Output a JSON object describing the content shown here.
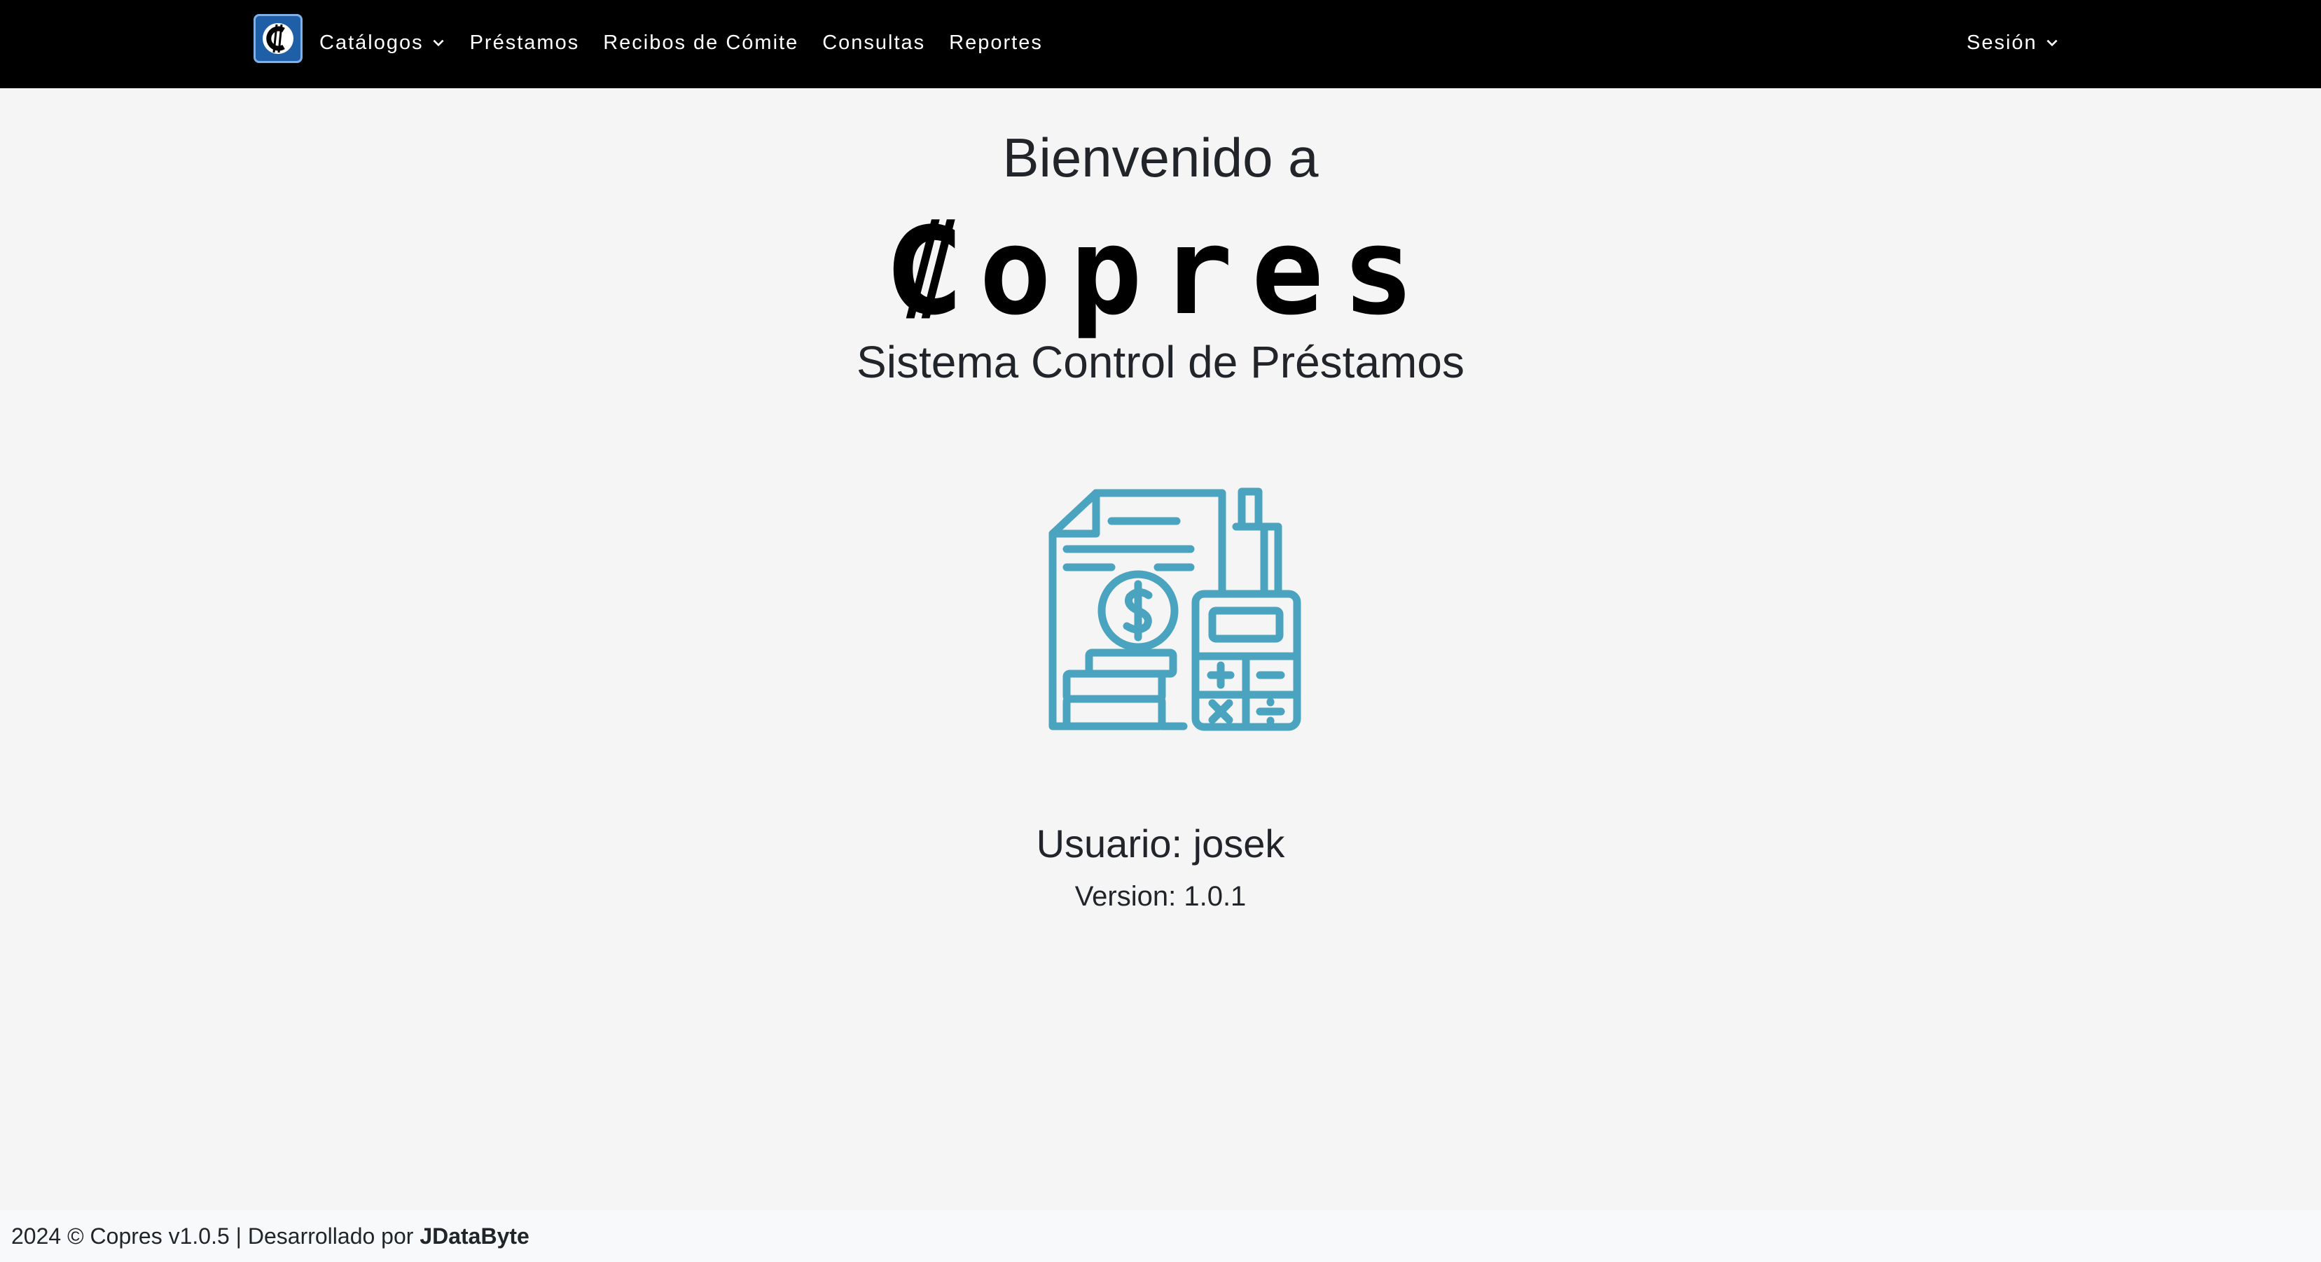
{
  "navbar": {
    "logo_icon": "copres-logo-icon",
    "items": [
      {
        "label": "Catálogos",
        "dropdown": true
      },
      {
        "label": "Préstamos"
      },
      {
        "label": "Recibos de Cómite"
      },
      {
        "label": "Consultas"
      },
      {
        "label": "Reportes"
      }
    ],
    "session_label": "Sesión"
  },
  "main": {
    "welcome": "Bienvenido a",
    "brand": "₡opres",
    "subtitle": "Sistema Control de Préstamos",
    "hero_icon": "loan-accounting-icon",
    "user_line": "Usuario: josek",
    "version_line": "Version: 1.0.1"
  },
  "footer": {
    "text": "2024 © Copres v1.0.5 | Desarrollado por",
    "developer": "JDataByte"
  },
  "colors": {
    "navbar_bg": "#000000",
    "page_bg": "#f5f5f5",
    "icon_accent": "#4aa3bf",
    "logo_bg": "#1e5fa8"
  }
}
